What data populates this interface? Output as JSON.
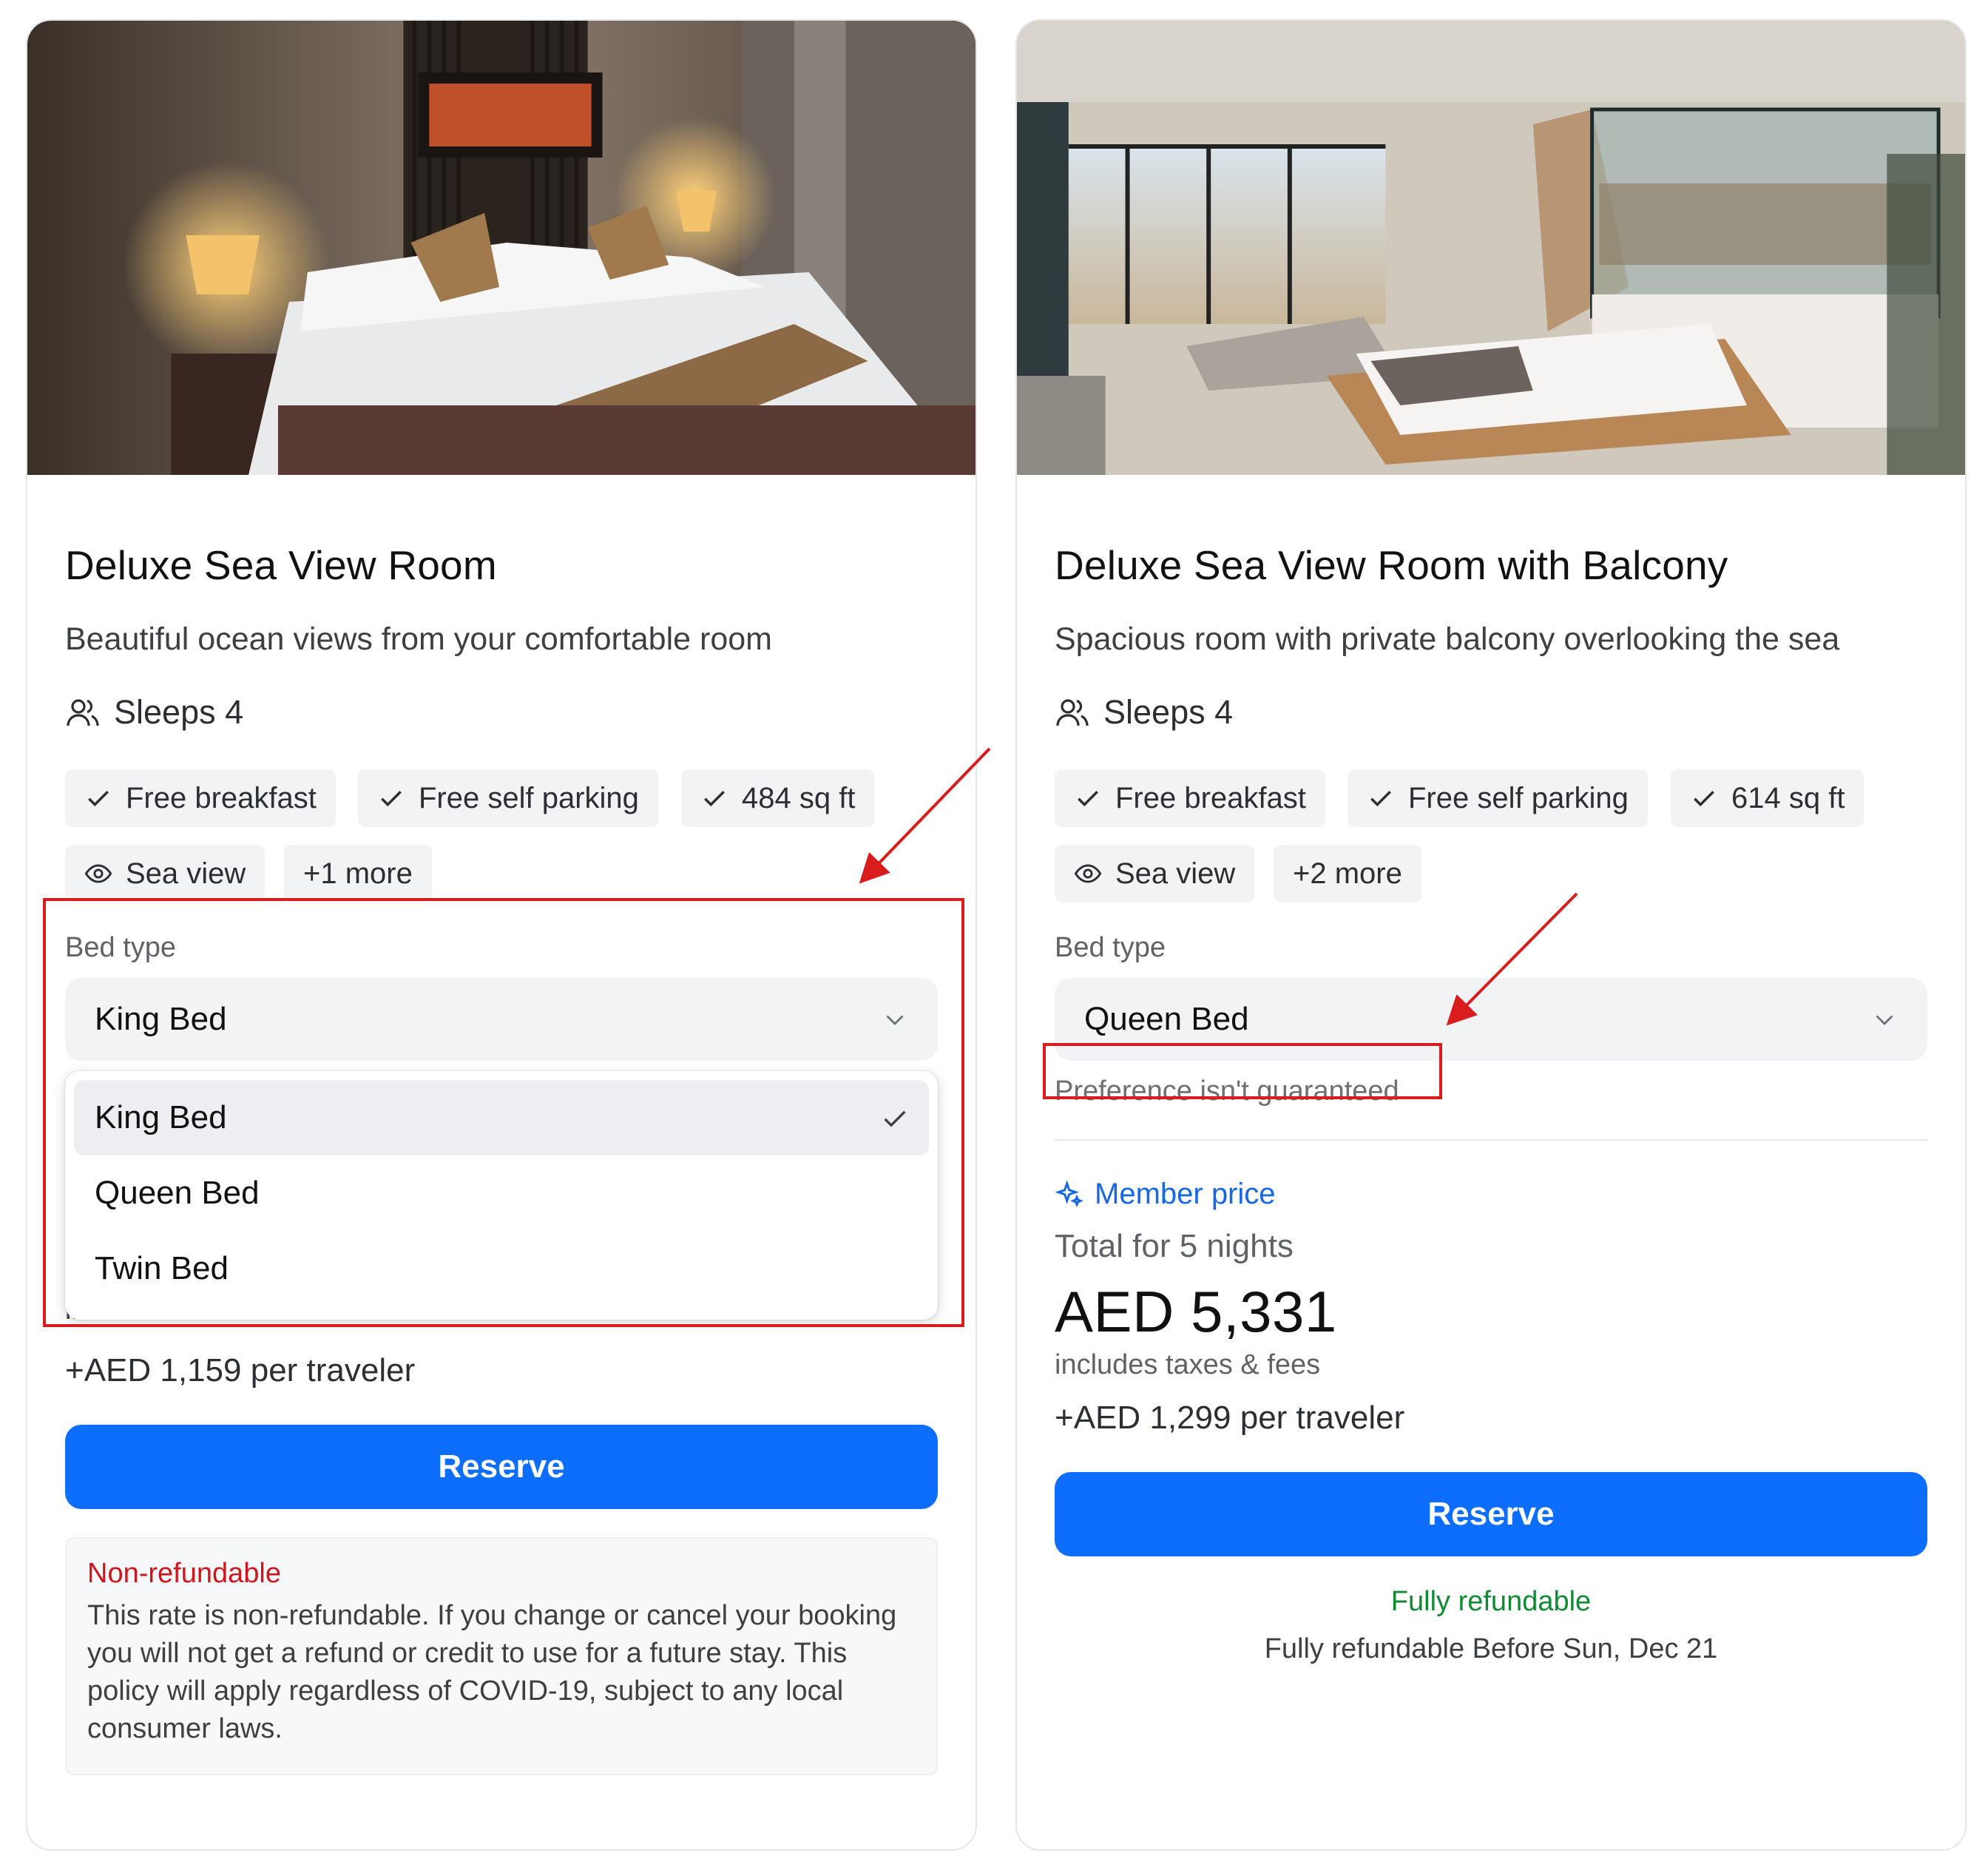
{
  "colors": {
    "primary": "#0d6efd",
    "member": "#1668e3",
    "non_refundable": "#d0161c",
    "refundable": "#108a33",
    "annotation": "#d91c1c"
  },
  "rooms": [
    {
      "title": "Deluxe Sea View Room",
      "description": "Beautiful ocean views from your comfortable room",
      "sleeps": "Sleeps 4",
      "amenities": [
        {
          "icon": "check-icon",
          "label": "Free breakfast"
        },
        {
          "icon": "check-icon",
          "label": "Free self parking"
        },
        {
          "icon": "check-icon",
          "label": "484 sq ft"
        },
        {
          "icon": "eye-icon",
          "label": "Sea view"
        },
        {
          "icon": "",
          "label": "+1 more"
        }
      ],
      "bed_type_label": "Bed type",
      "bed_selected": "King Bed",
      "bed_options": [
        "King Bed",
        "Queen Bed",
        "Twin Bed"
      ],
      "taxes_partial": "includes taxes & fees",
      "per_traveler": "+AED 1,159 per traveler",
      "reserve_label": "Reserve",
      "policy": {
        "title": "Non-refundable",
        "text": "This rate is non-refundable. If you change or cancel your booking you will not get a refund or credit to use for a future stay. This policy will apply regardless of COVID-19, subject to any local consumer laws."
      }
    },
    {
      "title": "Deluxe Sea View Room with Balcony",
      "description": "Spacious room with private balcony overlooking the sea",
      "sleeps": "Sleeps 4",
      "amenities": [
        {
          "icon": "check-icon",
          "label": "Free breakfast"
        },
        {
          "icon": "check-icon",
          "label": "Free self parking"
        },
        {
          "icon": "check-icon",
          "label": "614 sq ft"
        },
        {
          "icon": "eye-icon",
          "label": "Sea view"
        },
        {
          "icon": "",
          "label": "+2 more"
        }
      ],
      "bed_type_label": "Bed type",
      "bed_selected": "Queen Bed",
      "bed_note": "Preference isn't guaranteed",
      "member_price": "Member price",
      "total_label": "Total for 5 nights",
      "price": "AED 5,331",
      "taxes": "includes taxes & fees",
      "per_traveler": "+AED 1,299 per traveler",
      "reserve_label": "Reserve",
      "refund": {
        "title": "Fully refundable",
        "text": "Fully refundable Before Sun, Dec 21"
      }
    }
  ]
}
